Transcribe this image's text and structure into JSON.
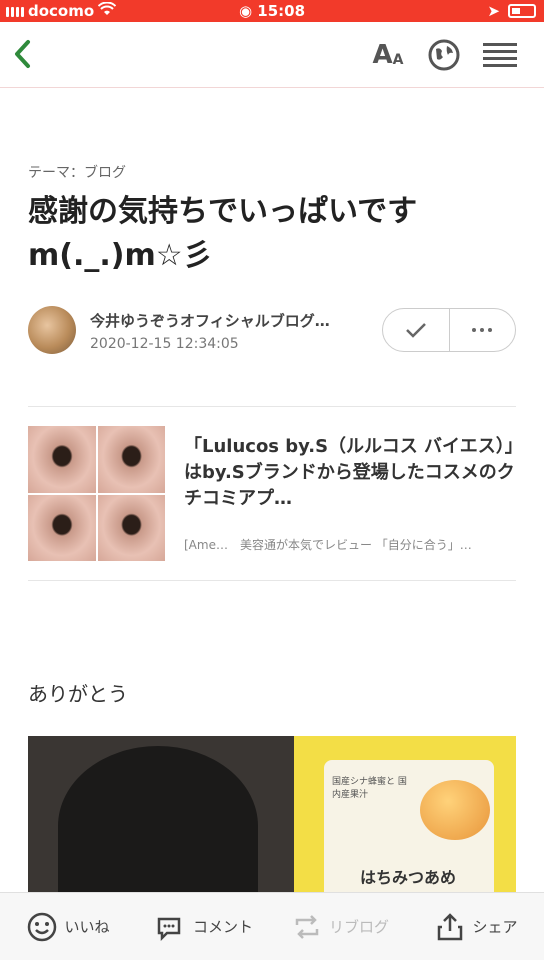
{
  "status_bar": {
    "carrier": "docomo",
    "time": "15:08"
  },
  "article": {
    "theme": "テーマ：ブログ",
    "title": "感謝の気持ちでいっぱいです m(._.)m☆彡",
    "author_name": "今井ゆうぞうオフィシャルブログ…",
    "date": "2020-12-15 12:34:05",
    "paragraph": "ありがとう"
  },
  "link_card": {
    "title": "「Lulucos by.S（ルルコス バイエス）」はby.Sブランドから登場したコスメのクチコミアプ…",
    "subtitle": "[Ame…　美容通が本気でレビュー 「自分に合う」…"
  },
  "photo_text": {
    "bag_label": "はちみつあめ",
    "bag_small": "国産シナ蜂蜜と 国内産果汁"
  },
  "bottom_bar": {
    "like": "いいね",
    "comment": "コメント",
    "reblog": "リブログ",
    "share": "シェア"
  },
  "nav": {
    "font_big": "A",
    "font_small": "A"
  },
  "colors": {
    "status_bar": "#f23a2a",
    "back_arrow": "#2f8a3b"
  }
}
